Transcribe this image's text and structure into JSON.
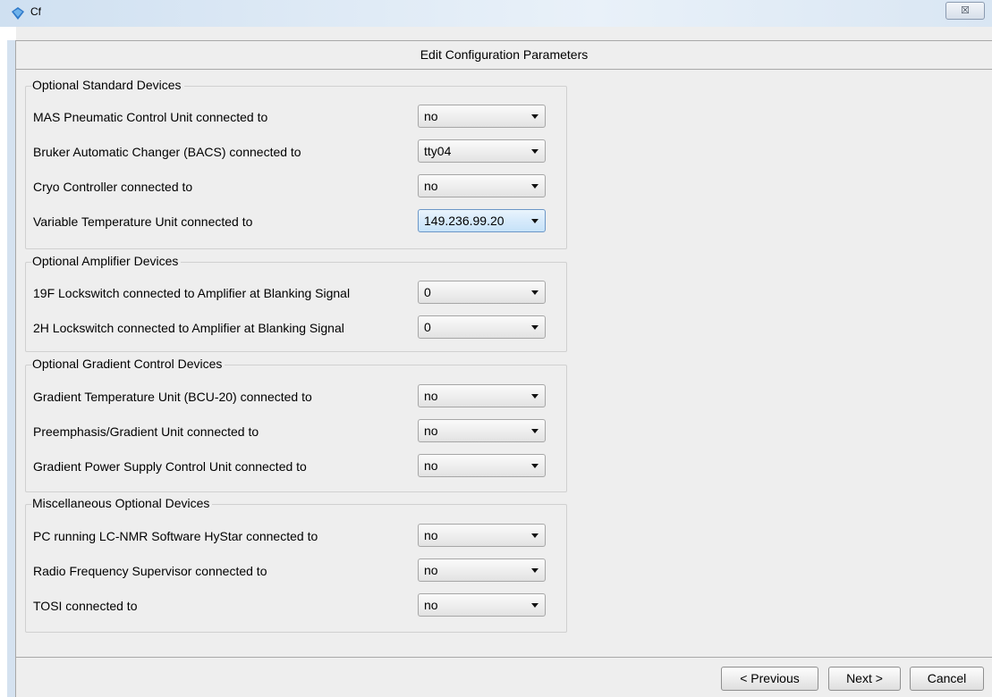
{
  "window": {
    "title": "Cf",
    "close_glyph": "☒"
  },
  "dialog": {
    "title": "Edit Configuration Parameters"
  },
  "groups": [
    {
      "title": "Optional Standard Devices",
      "rows": [
        {
          "label": "MAS Pneumatic Control Unit connected to",
          "value": "no"
        },
        {
          "label": "Bruker Automatic Changer (BACS) connected to",
          "value": "tty04"
        },
        {
          "label": "Cryo Controller connected to",
          "value": "no"
        },
        {
          "label": "Variable Temperature Unit connected to",
          "value": "149.236.99.20",
          "focused": true
        }
      ]
    },
    {
      "title": "Optional Amplifier Devices",
      "rows": [
        {
          "label": "19F Lockswitch connected to Amplifier at Blanking Signal",
          "value": "0"
        },
        {
          "label": "2H Lockswitch connected to Amplifier at Blanking Signal",
          "value": "0"
        }
      ]
    },
    {
      "title": "Optional Gradient Control Devices",
      "rows": [
        {
          "label": "Gradient Temperature Unit (BCU-20) connected to",
          "value": "no"
        },
        {
          "label": "Preemphasis/Gradient Unit connected to",
          "value": "no"
        },
        {
          "label": "Gradient Power Supply Control Unit connected to",
          "value": "no"
        }
      ]
    },
    {
      "title": "Miscellaneous Optional Devices",
      "rows": [
        {
          "label": "PC running LC-NMR Software HyStar connected to",
          "value": "no"
        },
        {
          "label": "Radio Frequency Supervisor connected to",
          "value": "no"
        },
        {
          "label": "TOSI connected to",
          "value": "no"
        }
      ]
    }
  ],
  "buttons": {
    "previous": "< Previous",
    "next": "Next >",
    "cancel": "Cancel"
  },
  "colors": {
    "focused_combo": "#d8ebfb",
    "panel_bg": "#eeeeee"
  }
}
